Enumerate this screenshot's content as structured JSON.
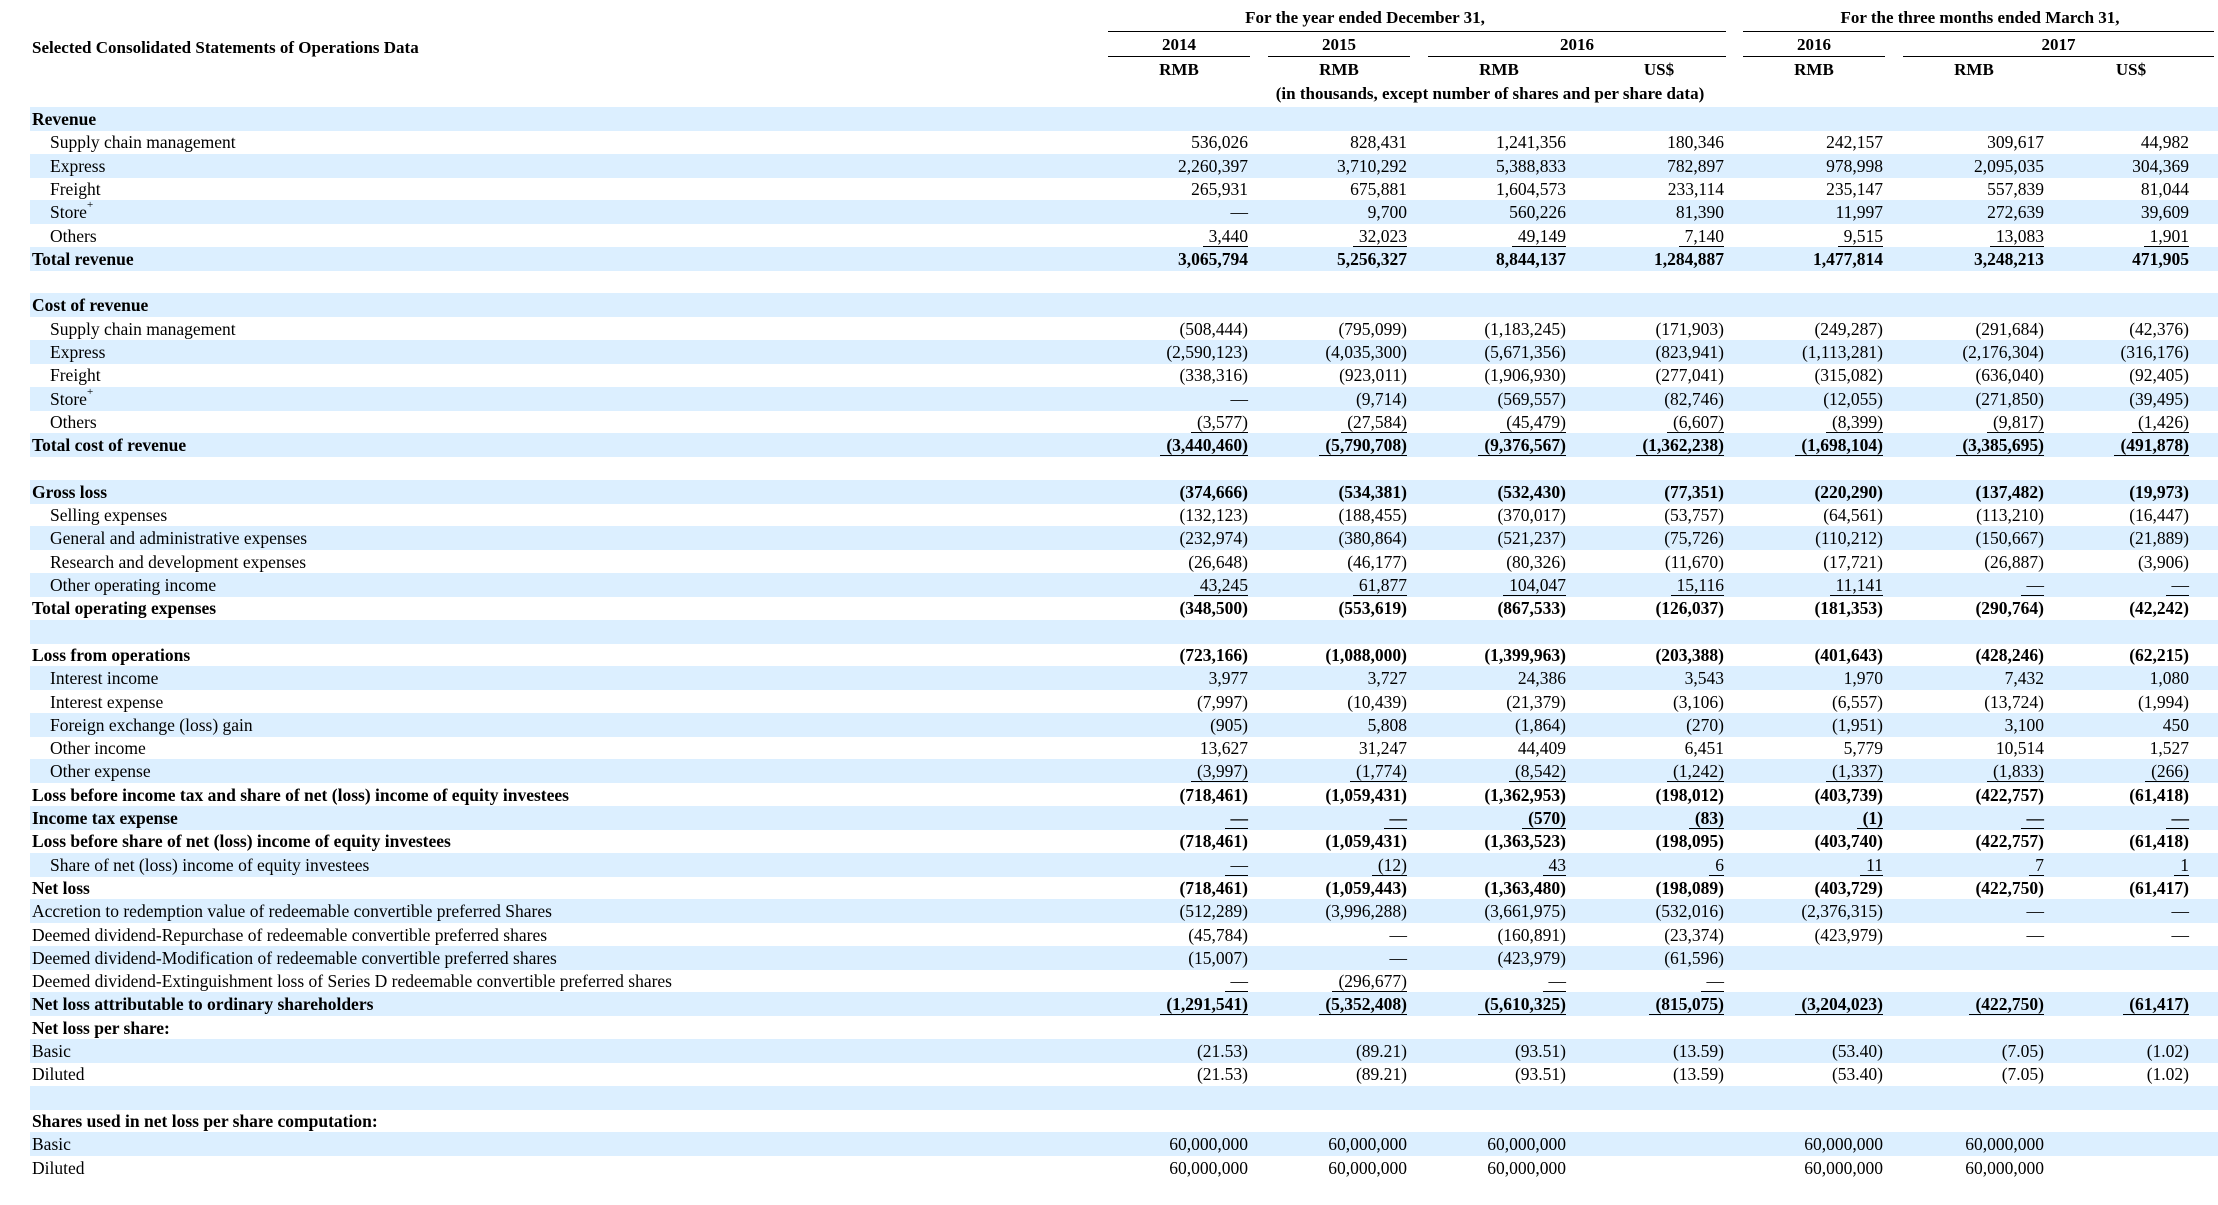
{
  "title": "Selected Consolidated Statements of Operations Data",
  "header": {
    "group_year": "For the year ended December 31,",
    "group_quarter": "For the three months ended March 31,",
    "years": [
      "2014",
      "2015",
      "2016",
      "2016",
      "2017"
    ],
    "currencies": [
      "RMB",
      "RMB",
      "RMB",
      "US$",
      "RMB",
      "RMB",
      "US$"
    ],
    "units_note": "(in thousands, except number of shares and per share data)"
  },
  "rows": [
    {
      "label": "Revenue",
      "level": 1,
      "bold": true,
      "values": [
        "",
        "",
        "",
        "",
        "",
        "",
        ""
      ]
    },
    {
      "label": "Supply chain management",
      "level": 2,
      "values": [
        "536,026",
        "828,431",
        "1,241,356",
        "180,346",
        "242,157",
        "309,617",
        "44,982"
      ]
    },
    {
      "label": "Express",
      "level": 2,
      "values": [
        "2,260,397",
        "3,710,292",
        "5,388,833",
        "782,897",
        "978,998",
        "2,095,035",
        "304,369"
      ]
    },
    {
      "label": "Freight",
      "level": 2,
      "values": [
        "265,931",
        "675,881",
        "1,604,573",
        "233,114",
        "235,147",
        "557,839",
        "81,044"
      ]
    },
    {
      "label": "Store",
      "sup": "+",
      "level": 2,
      "values": [
        "—",
        "9,700",
        "560,226",
        "81,390",
        "11,997",
        "272,639",
        "39,609"
      ]
    },
    {
      "label": "Others",
      "level": 2,
      "ul": true,
      "values": [
        "3,440",
        "32,023",
        "49,149",
        "7,140",
        "9,515",
        "13,083",
        "1,901"
      ]
    },
    {
      "label": "Total revenue",
      "level": 1,
      "bold": true,
      "values": [
        "3,065,794",
        "5,256,327",
        "8,844,137",
        "1,284,887",
        "1,477,814",
        "3,248,213",
        "471,905"
      ]
    },
    {
      "label": "",
      "level": 1,
      "blank": true,
      "values": [
        "",
        "",
        "",
        "",
        "",
        "",
        ""
      ]
    },
    {
      "label": "Cost of revenue",
      "level": 1,
      "bold": true,
      "values": [
        "",
        "",
        "",
        "",
        "",
        "",
        ""
      ]
    },
    {
      "label": "Supply chain management",
      "level": 2,
      "values": [
        "(508,444)",
        "(795,099)",
        "(1,183,245)",
        "(171,903)",
        "(249,287)",
        "(291,684)",
        "(42,376)"
      ]
    },
    {
      "label": "Express",
      "level": 2,
      "values": [
        "(2,590,123)",
        "(4,035,300)",
        "(5,671,356)",
        "(823,941)",
        "(1,113,281)",
        "(2,176,304)",
        "(316,176)"
      ]
    },
    {
      "label": "Freight",
      "level": 2,
      "values": [
        "(338,316)",
        "(923,011)",
        "(1,906,930)",
        "(277,041)",
        "(315,082)",
        "(636,040)",
        "(92,405)"
      ]
    },
    {
      "label": "Store",
      "sup": "+",
      "level": 2,
      "values": [
        "—",
        "(9,714)",
        "(569,557)",
        "(82,746)",
        "(12,055)",
        "(271,850)",
        "(39,495)"
      ]
    },
    {
      "label": "Others",
      "level": 2,
      "ul": true,
      "values": [
        "(3,577)",
        "(27,584)",
        "(45,479)",
        "(6,607)",
        "(8,399)",
        "(9,817)",
        "(1,426)"
      ]
    },
    {
      "label": "Total cost of revenue",
      "level": 1,
      "bold": true,
      "ul": true,
      "values": [
        "(3,440,460)",
        "(5,790,708)",
        "(9,376,567)",
        "(1,362,238)",
        "(1,698,104)",
        "(3,385,695)",
        "(491,878)"
      ]
    },
    {
      "label": "",
      "level": 1,
      "blank": true,
      "values": [
        "",
        "",
        "",
        "",
        "",
        "",
        ""
      ]
    },
    {
      "label": "Gross loss",
      "level": 1,
      "bold": true,
      "values": [
        "(374,666)",
        "(534,381)",
        "(532,430)",
        "(77,351)",
        "(220,290)",
        "(137,482)",
        "(19,973)"
      ]
    },
    {
      "label": "Selling expenses",
      "level": 2,
      "values": [
        "(132,123)",
        "(188,455)",
        "(370,017)",
        "(53,757)",
        "(64,561)",
        "(113,210)",
        "(16,447)"
      ]
    },
    {
      "label": "General and administrative expenses",
      "level": 2,
      "values": [
        "(232,974)",
        "(380,864)",
        "(521,237)",
        "(75,726)",
        "(110,212)",
        "(150,667)",
        "(21,889)"
      ]
    },
    {
      "label": "Research and development expenses",
      "level": 2,
      "values": [
        "(26,648)",
        "(46,177)",
        "(80,326)",
        "(11,670)",
        "(17,721)",
        "(26,887)",
        "(3,906)"
      ]
    },
    {
      "label": "Other operating income",
      "level": 2,
      "ul": true,
      "values": [
        "43,245",
        "61,877",
        "104,047",
        "15,116",
        "11,141",
        "—",
        "—"
      ]
    },
    {
      "label": "Total operating expenses",
      "level": 1,
      "bold": true,
      "values": [
        "(348,500)",
        "(553,619)",
        "(867,533)",
        "(126,037)",
        "(181,353)",
        "(290,764)",
        "(42,242)"
      ]
    },
    {
      "label": "",
      "level": 1,
      "blank": true,
      "values": [
        "",
        "",
        "",
        "",
        "",
        "",
        ""
      ]
    },
    {
      "label": "Loss from operations",
      "level": 1,
      "bold": true,
      "values": [
        "(723,166)",
        "(1,088,000)",
        "(1,399,963)",
        "(203,388)",
        "(401,643)",
        "(428,246)",
        "(62,215)"
      ]
    },
    {
      "label": "Interest income",
      "level": 2,
      "values": [
        "3,977",
        "3,727",
        "24,386",
        "3,543",
        "1,970",
        "7,432",
        "1,080"
      ]
    },
    {
      "label": "Interest expense",
      "level": 2,
      "values": [
        "(7,997)",
        "(10,439)",
        "(21,379)",
        "(3,106)",
        "(6,557)",
        "(13,724)",
        "(1,994)"
      ]
    },
    {
      "label": "Foreign exchange (loss) gain",
      "level": 2,
      "values": [
        "(905)",
        "5,808",
        "(1,864)",
        "(270)",
        "(1,951)",
        "3,100",
        "450"
      ]
    },
    {
      "label": "Other income",
      "level": 2,
      "values": [
        "13,627",
        "31,247",
        "44,409",
        "6,451",
        "5,779",
        "10,514",
        "1,527"
      ]
    },
    {
      "label": "Other expense",
      "level": 2,
      "ul": true,
      "values": [
        "(3,997)",
        "(1,774)",
        "(8,542)",
        "(1,242)",
        "(1,337)",
        "(1,833)",
        "(266)"
      ]
    },
    {
      "label": "Loss before income tax and share of net (loss) income of equity investees",
      "level": 1,
      "bold": true,
      "values": [
        "(718,461)",
        "(1,059,431)",
        "(1,362,953)",
        "(198,012)",
        "(403,739)",
        "(422,757)",
        "(61,418)"
      ]
    },
    {
      "label": "Income tax expense",
      "level": 1,
      "bold": true,
      "ul": true,
      "values": [
        "—",
        "—",
        "(570)",
        "(83)",
        "(1)",
        "—",
        "—"
      ]
    },
    {
      "label": "Loss before share of net (loss) income of equity investees",
      "level": 1,
      "bold": true,
      "values": [
        "(718,461)",
        "(1,059,431)",
        "(1,363,523)",
        "(198,095)",
        "(403,740)",
        "(422,757)",
        "(61,418)"
      ]
    },
    {
      "label": "Share of net (loss) income of equity investees",
      "level": 2,
      "ul": true,
      "values": [
        "—",
        "(12)",
        "43",
        "6",
        "11",
        "7",
        "1"
      ]
    },
    {
      "label": "Net loss",
      "level": 1,
      "bold": true,
      "values": [
        "(718,461)",
        "(1,059,443)",
        "(1,363,480)",
        "(198,089)",
        "(403,729)",
        "(422,750)",
        "(61,417)"
      ]
    },
    {
      "label": "Accretion to redemption value of redeemable convertible preferred Shares",
      "level": 1,
      "values": [
        "(512,289)",
        "(3,996,288)",
        "(3,661,975)",
        "(532,016)",
        "(2,376,315)",
        "—",
        "—"
      ]
    },
    {
      "label": "Deemed dividend-Repurchase of redeemable convertible preferred shares",
      "level": 1,
      "values": [
        "(45,784)",
        "—",
        "(160,891)",
        "(23,374)",
        "(423,979)",
        "—",
        "—"
      ]
    },
    {
      "label": "Deemed dividend-Modification of redeemable convertible preferred shares",
      "level": 1,
      "values": [
        "(15,007)",
        "—",
        "(423,979)",
        "(61,596)",
        "",
        "",
        ""
      ]
    },
    {
      "label": "Deemed dividend-Extinguishment loss of Series D redeemable convertible preferred shares",
      "level": 1,
      "ul": true,
      "values": [
        "—",
        "(296,677)",
        "—",
        "—",
        "",
        "",
        ""
      ]
    },
    {
      "label": "Net loss attributable to ordinary shareholders",
      "level": 1,
      "bold": true,
      "ul": true,
      "values": [
        "(1,291,541)",
        "(5,352,408)",
        "(5,610,325)",
        "(815,075)",
        "(3,204,023)",
        "(422,750)",
        "(61,417)"
      ]
    },
    {
      "label": "Net loss per share:",
      "level": 1,
      "bold": true,
      "values": [
        "",
        "",
        "",
        "",
        "",
        "",
        ""
      ]
    },
    {
      "label": "Basic",
      "level": 1,
      "values": [
        "(21.53)",
        "(89.21)",
        "(93.51)",
        "(13.59)",
        "(53.40)",
        "(7.05)",
        "(1.02)"
      ]
    },
    {
      "label": "Diluted",
      "level": 1,
      "values": [
        "(21.53)",
        "(89.21)",
        "(93.51)",
        "(13.59)",
        "(53.40)",
        "(7.05)",
        "(1.02)"
      ]
    },
    {
      "label": "",
      "level": 1,
      "blank": true,
      "values": [
        "",
        "",
        "",
        "",
        "",
        "",
        ""
      ]
    },
    {
      "label": "Shares used in net loss per share computation:",
      "level": 1,
      "bold": true,
      "values": [
        "",
        "",
        "",
        "",
        "",
        "",
        ""
      ]
    },
    {
      "label": "Basic",
      "level": 1,
      "values": [
        "60,000,000",
        "60,000,000",
        "60,000,000",
        "",
        "60,000,000",
        "60,000,000",
        ""
      ]
    },
    {
      "label": "Diluted",
      "level": 1,
      "values": [
        "60,000,000",
        "60,000,000",
        "60,000,000",
        "",
        "60,000,000",
        "60,000,000",
        ""
      ]
    }
  ]
}
